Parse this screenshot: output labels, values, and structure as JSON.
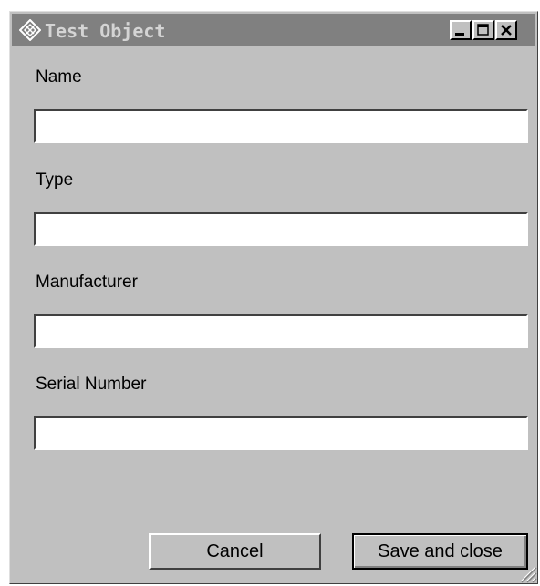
{
  "window": {
    "title": "Test Object",
    "minimize_icon": "minimize-icon",
    "maximize_icon": "maximize-icon",
    "close_icon": "close-icon",
    "app_icon": "diamond-app-icon"
  },
  "form": {
    "name_label": "Name",
    "name_value": "",
    "type_label": "Type",
    "type_value": "",
    "manufacturer_label": "Manufacturer",
    "manufacturer_value": "",
    "serial_label": "Serial Number",
    "serial_value": ""
  },
  "buttons": {
    "cancel": "Cancel",
    "save": "Save and close"
  },
  "colors": {
    "window_bg": "#c0c0c0",
    "titlebar_bg": "#808080",
    "title_text": "#d4d4d4"
  }
}
